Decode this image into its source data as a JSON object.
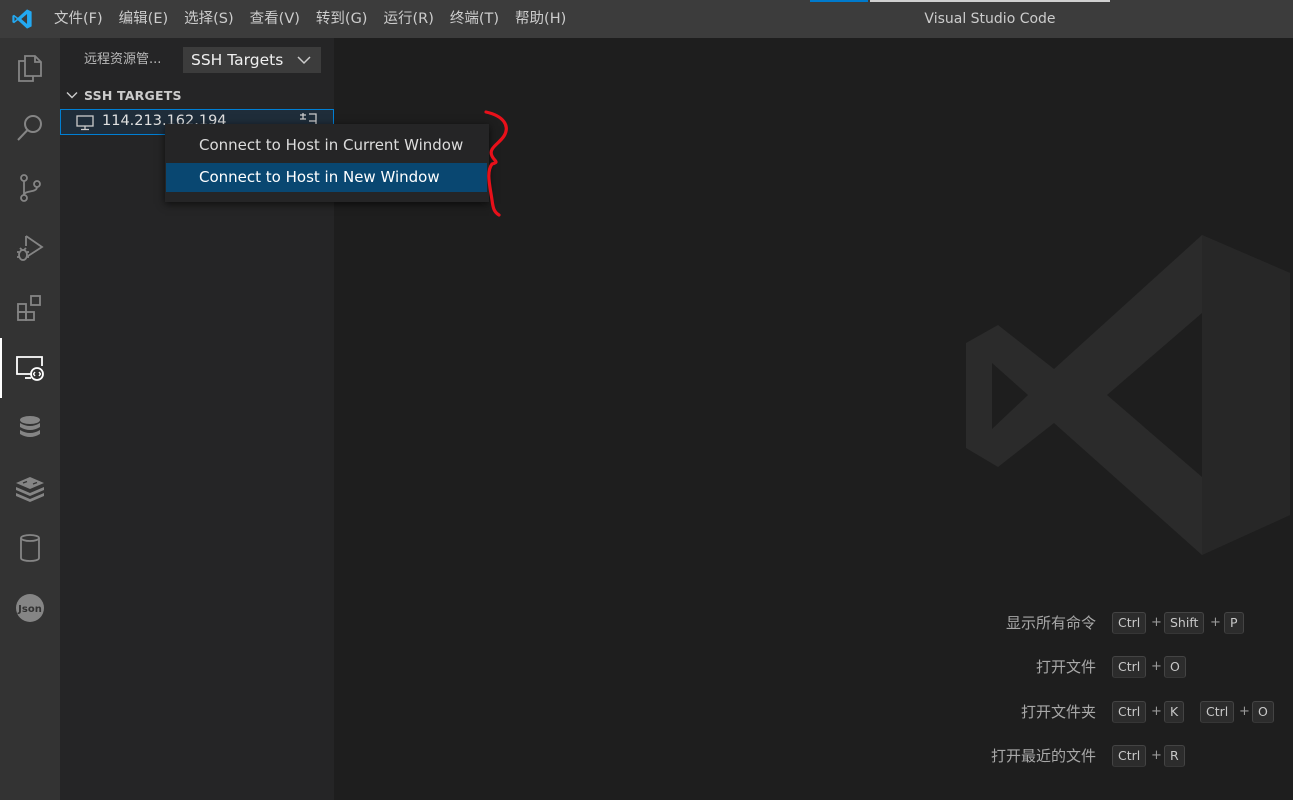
{
  "titlebar": {
    "menu": [
      "文件(F)",
      "编辑(E)",
      "选择(S)",
      "查看(V)",
      "转到(G)",
      "运行(R)",
      "终端(T)",
      "帮助(H)"
    ],
    "window_title": "Visual Studio Code"
  },
  "activitybar": {
    "items": [
      {
        "name": "explorer-icon",
        "active": false
      },
      {
        "name": "search-icon",
        "active": false
      },
      {
        "name": "source-control-icon",
        "active": false
      },
      {
        "name": "run-debug-icon",
        "active": false
      },
      {
        "name": "extensions-icon",
        "active": false
      },
      {
        "name": "remote-explorer-icon",
        "active": true
      },
      {
        "name": "database-icon",
        "active": false
      },
      {
        "name": "redis-stack-icon",
        "active": false
      },
      {
        "name": "sql-cylinder-icon",
        "active": false
      },
      {
        "name": "json-icon",
        "active": false
      }
    ],
    "json_badge": "Json"
  },
  "sidebar": {
    "title": "远程资源管...",
    "select_value": "SSH Targets",
    "section_title": "SSH TARGETS",
    "host_label": "114.213.162.194"
  },
  "context_menu": {
    "items": [
      {
        "label": "Connect to Host in Current Window",
        "selected": false
      },
      {
        "label": "Connect to Host in New Window",
        "selected": true
      }
    ]
  },
  "editor": {
    "shortcuts": [
      {
        "label": "显示所有命令",
        "keys": [
          "Ctrl",
          "+",
          "Shift",
          "+",
          "P"
        ]
      },
      {
        "label": "打开文件",
        "keys": [
          "Ctrl",
          "+",
          "O"
        ]
      },
      {
        "label": "打开文件夹",
        "keys": [
          "Ctrl",
          "+",
          "K",
          "Ctrl",
          "+",
          "O"
        ]
      },
      {
        "label": "打开最近的文件",
        "keys": [
          "Ctrl",
          "+",
          "R"
        ]
      }
    ]
  },
  "colors": {
    "titlebar": "#3c3c3c",
    "activitybar": "#333333",
    "sidebar": "#252526",
    "editor": "#1e1e1e",
    "selection": "#094771",
    "focus_border": "#007fd4",
    "annotation": "#e8101a"
  }
}
